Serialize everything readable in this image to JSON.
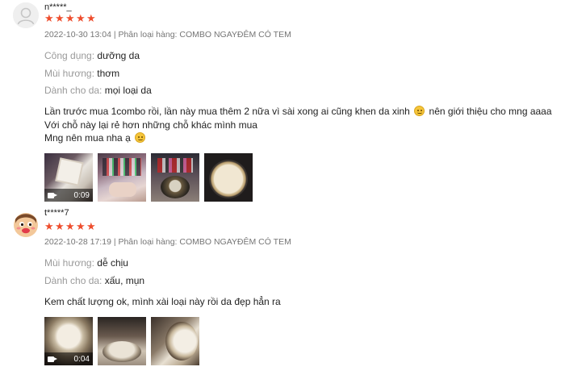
{
  "reviews": [
    {
      "username": "n*****_",
      "avatar_icon": "default-user-icon",
      "rating": 5,
      "date": "2022-10-30 13:04",
      "variation_label": "Phân loại hàng:",
      "variation": "COMBO NGAYĐÊM CÓ TEM",
      "attributes": [
        {
          "key": "Công dụng:",
          "value": "dưỡng da"
        },
        {
          "key": "Mùi hương:",
          "value": "thơm"
        },
        {
          "key": "Dành cho da:",
          "value": "mọi loại da"
        }
      ],
      "comment_lines": [
        {
          "text": "Lần trước mua 1combo rồi, lần này mua thêm 2 nữa vì sài xong ai cũng khen da xinh",
          "emoji": "smile-emoji",
          "after": "nên giới thiệu cho mng aaaa"
        },
        {
          "text": "Với chỗ này lại rẻ hơn những chỗ khác mình mua"
        },
        {
          "text": "Mng nên mua nha ạ",
          "emoji": "smile-emoji"
        }
      ],
      "media": [
        {
          "type": "video",
          "duration": "0:09"
        },
        {
          "type": "image"
        },
        {
          "type": "image"
        },
        {
          "type": "image"
        }
      ]
    },
    {
      "username": "t*****7",
      "avatar_icon": "cartoon-face-icon",
      "rating": 5,
      "date": "2022-10-28 17:19",
      "variation_label": "Phân loại hàng:",
      "variation": "COMBO NGAYĐÊM CÓ TEM",
      "attributes": [
        {
          "key": "Mùi hương:",
          "value": "dễ chịu"
        },
        {
          "key": "Dành cho da:",
          "value": "xấu, mụn"
        }
      ],
      "comment_lines": [
        {
          "text": "Kem chất lượng ok, mình xài loại này rồi da đẹp hẳn ra"
        }
      ],
      "media": [
        {
          "type": "video",
          "duration": "0:04"
        },
        {
          "type": "image"
        },
        {
          "type": "image"
        }
      ]
    }
  ],
  "colors": {
    "star": "#ee4d2d",
    "meta": "#757575",
    "label": "#9a9a9a"
  }
}
